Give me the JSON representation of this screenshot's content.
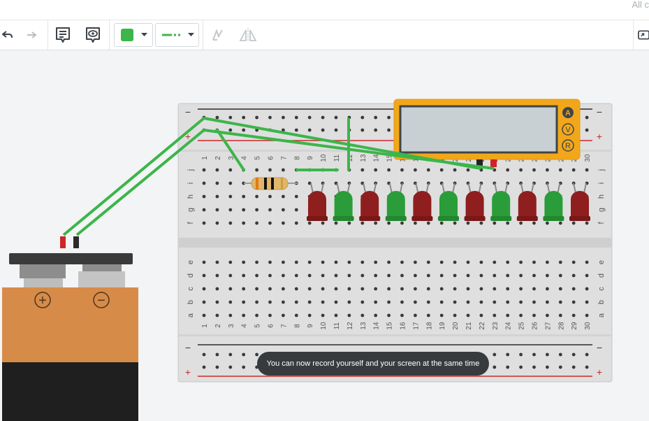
{
  "topbar": {
    "text": "All c"
  },
  "toolbar": {
    "undo_icon": "undo-arrow-icon",
    "redo_icon": "redo-arrow-icon",
    "notes_icon": "notes-icon",
    "visibility_icon": "visibility-eye-icon",
    "color_swatch": "#3cb54a",
    "flip_icon": "flip-icon",
    "mirror_icon": "mirror-icon",
    "fit_icon": "zoom-to-fit-icon"
  },
  "breadboard": {
    "rail_minus": "−",
    "rail_plus": "+",
    "row_letters_top": [
      "j",
      "i",
      "h",
      "g",
      "f"
    ],
    "row_letters_bottom": [
      "e",
      "d",
      "c",
      "b",
      "a"
    ],
    "column_numbers": [
      "1",
      "2",
      "3",
      "4",
      "5",
      "6",
      "7",
      "8",
      "9",
      "10",
      "11",
      "12",
      "13",
      "14",
      "15",
      "16",
      "17",
      "18",
      "19",
      "20",
      "21",
      "22",
      "23",
      "24",
      "25",
      "26",
      "27",
      "28",
      "29",
      "30"
    ]
  },
  "multimeter": {
    "modes": [
      "A",
      "V",
      "R"
    ]
  },
  "led_colors": [
    "red",
    "green",
    "red",
    "green",
    "red",
    "green",
    "red",
    "green",
    "red",
    "green",
    "red"
  ],
  "battery": {
    "plus": "+",
    "minus": "−"
  },
  "toast": {
    "text": "You can now record yourself and your screen at the same time"
  }
}
